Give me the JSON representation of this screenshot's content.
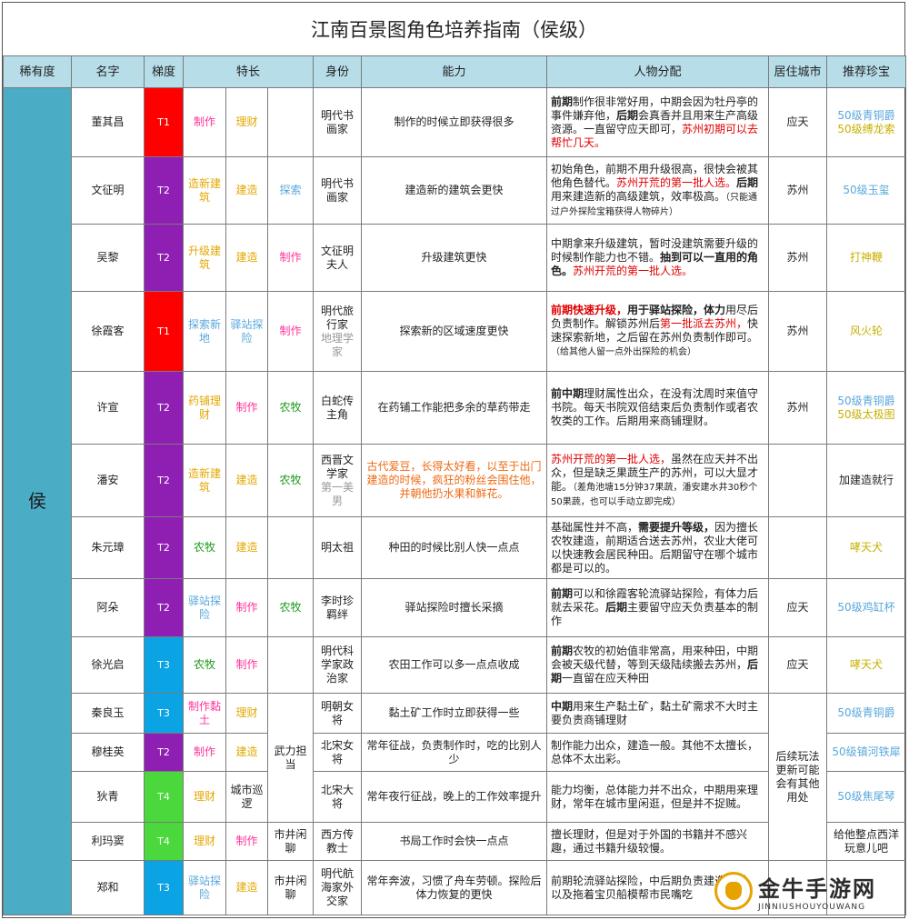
{
  "title": "江南百景图角色培养指南（侯级）",
  "headers": [
    "稀有度",
    "名字",
    "梯度",
    "特长",
    "身份",
    "能力",
    "人物分配",
    "居住城市",
    "推荐珍宝"
  ],
  "rarity": "侯",
  "colors": {
    "T1": "#ff0000",
    "T2": "#8e1fb2",
    "T3": "#0aa3e3",
    "T4": "#4bd83c",
    "rarity": "#4bacc6",
    "header": "#b7dde8"
  },
  "rows": [
    {
      "name": "董其昌",
      "tier": "T1",
      "sp1": "制作",
      "sp2": "理财",
      "sp3": "",
      "id": "明代书画家",
      "id_extra": "",
      "ability": "制作的时候立即获得很多",
      "alloc": [
        {
          "t": "前期",
          "b": 1
        },
        {
          "t": "制作很非常好用，中期会因为牡丹亭的事件嫌弃他，"
        },
        {
          "t": "后期",
          "b": 1
        },
        {
          "t": "会真香并且用来生产高级资源。一直留守应天即可，"
        },
        {
          "t": "苏州初期可以去帮忙几天。",
          "c": "c-red"
        }
      ],
      "city": "应天",
      "treasure": [
        "50级青铜爵",
        "50级缚龙索"
      ]
    },
    {
      "name": "文征明",
      "tier": "T2",
      "sp1": "造新建筑",
      "sp2": "建造",
      "sp3": "探索",
      "id": "明代书画家",
      "id_extra": "",
      "ability": "建造新的建筑会更快",
      "alloc": [
        {
          "t": "初始角色，前期不用升级很高，很快会被其他角色替代。"
        },
        {
          "t": "苏州开荒的第一批人选。",
          "c": "c-red"
        },
        {
          "t": "后期",
          "b": 1
        },
        {
          "t": "用来建造新的高级建筑，效率极高。"
        },
        {
          "t": "（只能通过户外探险宝箱获得人物碎片）",
          "s": 1
        }
      ],
      "city": "苏州",
      "treasure": [
        "50级玉玺"
      ]
    },
    {
      "name": "吴黎",
      "tier": "T2",
      "sp1": "升级建筑",
      "sp2": "建造",
      "sp3": "制作",
      "id": "文征明夫人",
      "id_extra": "",
      "ability": "升级建筑更快",
      "alloc": [
        {
          "t": "中期拿来升级建筑，暂时没建筑需要升级的时候制作能力也不错。"
        },
        {
          "t": "抽到可以一直用的角色。",
          "b": 1
        },
        {
          "t": "苏州开荒的第一批人选。",
          "c": "c-red"
        }
      ],
      "city": "苏州",
      "treasure": [
        "打神鞭"
      ]
    },
    {
      "name": "徐霞客",
      "tier": "T1",
      "sp1": "探索新地",
      "sp2": "驿站探险",
      "sp3": "制作",
      "id": "明代旅行家",
      "id_extra": "地理学家",
      "ability": "探索新的区域速度更快",
      "alloc": [
        {
          "t": "前期快速升级，",
          "c": "c-red",
          "b": 1
        },
        {
          "t": "用于驿站探险，体力",
          "b": 1
        },
        {
          "t": "用尽后负责制作。解锁苏州后"
        },
        {
          "t": "第一批派去苏州，",
          "c": "c-red"
        },
        {
          "t": "快速探索新地，之后留在苏州负责制作即可。"
        },
        {
          "t": "（给其他人留一点外出探险的机会）",
          "s": 1
        }
      ],
      "city": "苏州",
      "treasure": [
        "风火轮"
      ]
    },
    {
      "name": "许宣",
      "tier": "T2",
      "sp1": "药铺理财",
      "sp2": "制作",
      "sp3": "农牧",
      "id": "白蛇传主角",
      "id_extra": "",
      "ability": "在药铺工作能把多余的草药带走",
      "alloc": [
        {
          "t": "前中期",
          "b": 1
        },
        {
          "t": "理财属性出众，在没有沈周时来值守书院。每天书院双倍结束后负责制作或者农牧类的工作。后期用来商铺理财。"
        }
      ],
      "city": "苏州",
      "treasure": [
        "50级青铜爵",
        "50级太极图"
      ]
    },
    {
      "name": "潘安",
      "tier": "T2",
      "sp1": "造新建筑",
      "sp2": "建造",
      "sp3": "农牧",
      "id": "西晋文学家",
      "id_extra": "第一美男",
      "ability": "古代爱豆，长得太好看，以至于出门建造的时候，疯狂的粉丝会围住他，并朝他扔水果和鲜花。",
      "ability_color": "c-orange",
      "alloc": [
        {
          "t": "苏州开荒的第一批人选，",
          "c": "c-red"
        },
        {
          "t": "虽然在应天并不出众，但是缺乏果蔬生产的苏州，可以大显才能。"
        },
        {
          "t": "（差角池塘15分钟37果蔬，潘安建水井30秒个50果蔬，也可以手动立即完成）",
          "s": 1
        }
      ],
      "city": "",
      "treasure": [
        "加建造就行"
      ]
    },
    {
      "name": "朱元璋",
      "tier": "T2",
      "sp1": "农牧",
      "sp2": "建造",
      "sp3": "",
      "id": "明太祖",
      "id_extra": "",
      "ability": "种田的时候比别人快一点点",
      "alloc": [
        {
          "t": "基础属性并不高，"
        },
        {
          "t": "需要提升等级，",
          "b": 1
        },
        {
          "t": "因为擅长农牧建造，前期适合送去苏州，农业大佬可以快速教会居民种田。后期留守在哪个城市都是可以的。"
        }
      ],
      "city": "",
      "treasure": [
        "哮天犬"
      ]
    },
    {
      "name": "阿朵",
      "tier": "T2",
      "sp1": "驿站探险",
      "sp2": "制作",
      "sp3": "农牧",
      "id": "李时珍羁绊",
      "id_extra": "",
      "ability": "驿站探险时擅长采摘",
      "alloc": [
        {
          "t": "前期",
          "b": 1
        },
        {
          "t": "可以和徐霞客轮流驿站探险，有体力后就去采花。"
        },
        {
          "t": "后期",
          "b": 1
        },
        {
          "t": "主要留守应天负责基本的制作"
        }
      ],
      "city": "应天",
      "treasure": [
        "50级鸡缸杯"
      ]
    },
    {
      "name": "徐光启",
      "tier": "T3",
      "sp1": "农牧",
      "sp2": "制作",
      "sp3": "",
      "id": "明代科学家政治家",
      "id_extra": "",
      "ability": "农田工作可以多一点点收成",
      "alloc": [
        {
          "t": "前期",
          "b": 1
        },
        {
          "t": "农牧的初始值非常高，用来种田，中期会被天级代替，等到天级陆续搬去苏州，"
        },
        {
          "t": "后期",
          "b": 1
        },
        {
          "t": "一直留在应天种田"
        }
      ],
      "city": "应天",
      "treasure": [
        "哮天犬"
      ]
    },
    {
      "name": "秦良玉",
      "tier": "T3",
      "sp1": "制作黏土",
      "sp2": "理财",
      "sp3": "",
      "id": "明朝女将",
      "id_extra": "",
      "ability": "黏土矿工作时立即获得一些",
      "alloc": [
        {
          "t": "中期",
          "b": 1
        },
        {
          "t": "用来生产黏土矿，黏土矿需求不大时主要负责商铺理财"
        }
      ],
      "city": "",
      "treasure": [
        "50级青铜爵"
      ]
    },
    {
      "name": "穆桂英",
      "tier": "T2",
      "sp1": "制作",
      "sp2": "建造",
      "sp3": "",
      "id": "北宋女将",
      "id_extra": "",
      "ability": "常年征战，负责制作时，吃的比别人少",
      "alloc": [
        {
          "t": "制作能力出众，建造一般。其他不太擅长，总体不太出彩。"
        }
      ],
      "city": "",
      "treasure": [
        "50级镇河铁犀"
      ]
    },
    {
      "name": "狄青",
      "tier": "T4",
      "sp1": "理财",
      "sp2": "城市巡逻",
      "sp3": "",
      "id": "北宋大将",
      "id_extra": "",
      "ability": "常年夜行征战，晚上的工作效率提升",
      "alloc": [
        {
          "t": "能力均衡，总体能力并不出众，中期用来理财，常年在城市里闲逛，但是并不捉贼。"
        }
      ],
      "city": "",
      "treasure": [
        "50级焦尾琴"
      ]
    },
    {
      "name": "利玛窦",
      "tier": "T4",
      "sp1": "理财",
      "sp2": "制作",
      "sp3": "市井闲聊",
      "id": "西方传教士",
      "id_extra": "",
      "ability": "书局工作时会快一点点",
      "alloc": [
        {
          "t": "擅长理财，但是对于外国的书籍并不感兴趣，通过书籍升级较慢。"
        }
      ],
      "city": "",
      "treasure": [
        "给他整点西洋玩意儿吧"
      ]
    },
    {
      "name": "郑和",
      "tier": "T3",
      "sp1": "驿站探险",
      "sp2": "建造",
      "sp3": "市井闲聊",
      "id": "明代航海家外交家",
      "id_extra": "",
      "ability": "常年奔波，习惯了舟车劳顿。探险后体力恢复的更快",
      "alloc": [
        {
          "t": "前期轮流驿站探险，中后期负责建造理财，以及拖着宝贝船模帮市民嘴吃"
        }
      ],
      "city": "",
      "treasure": [
        ""
      ]
    }
  ],
  "shared": {
    "special_martial": "武力担当",
    "city_later": "后续玩法更新可能会有其他用处"
  },
  "logo": {
    "main": "金牛手游网",
    "sub": "JINNIUSHOUYOUWANG"
  }
}
